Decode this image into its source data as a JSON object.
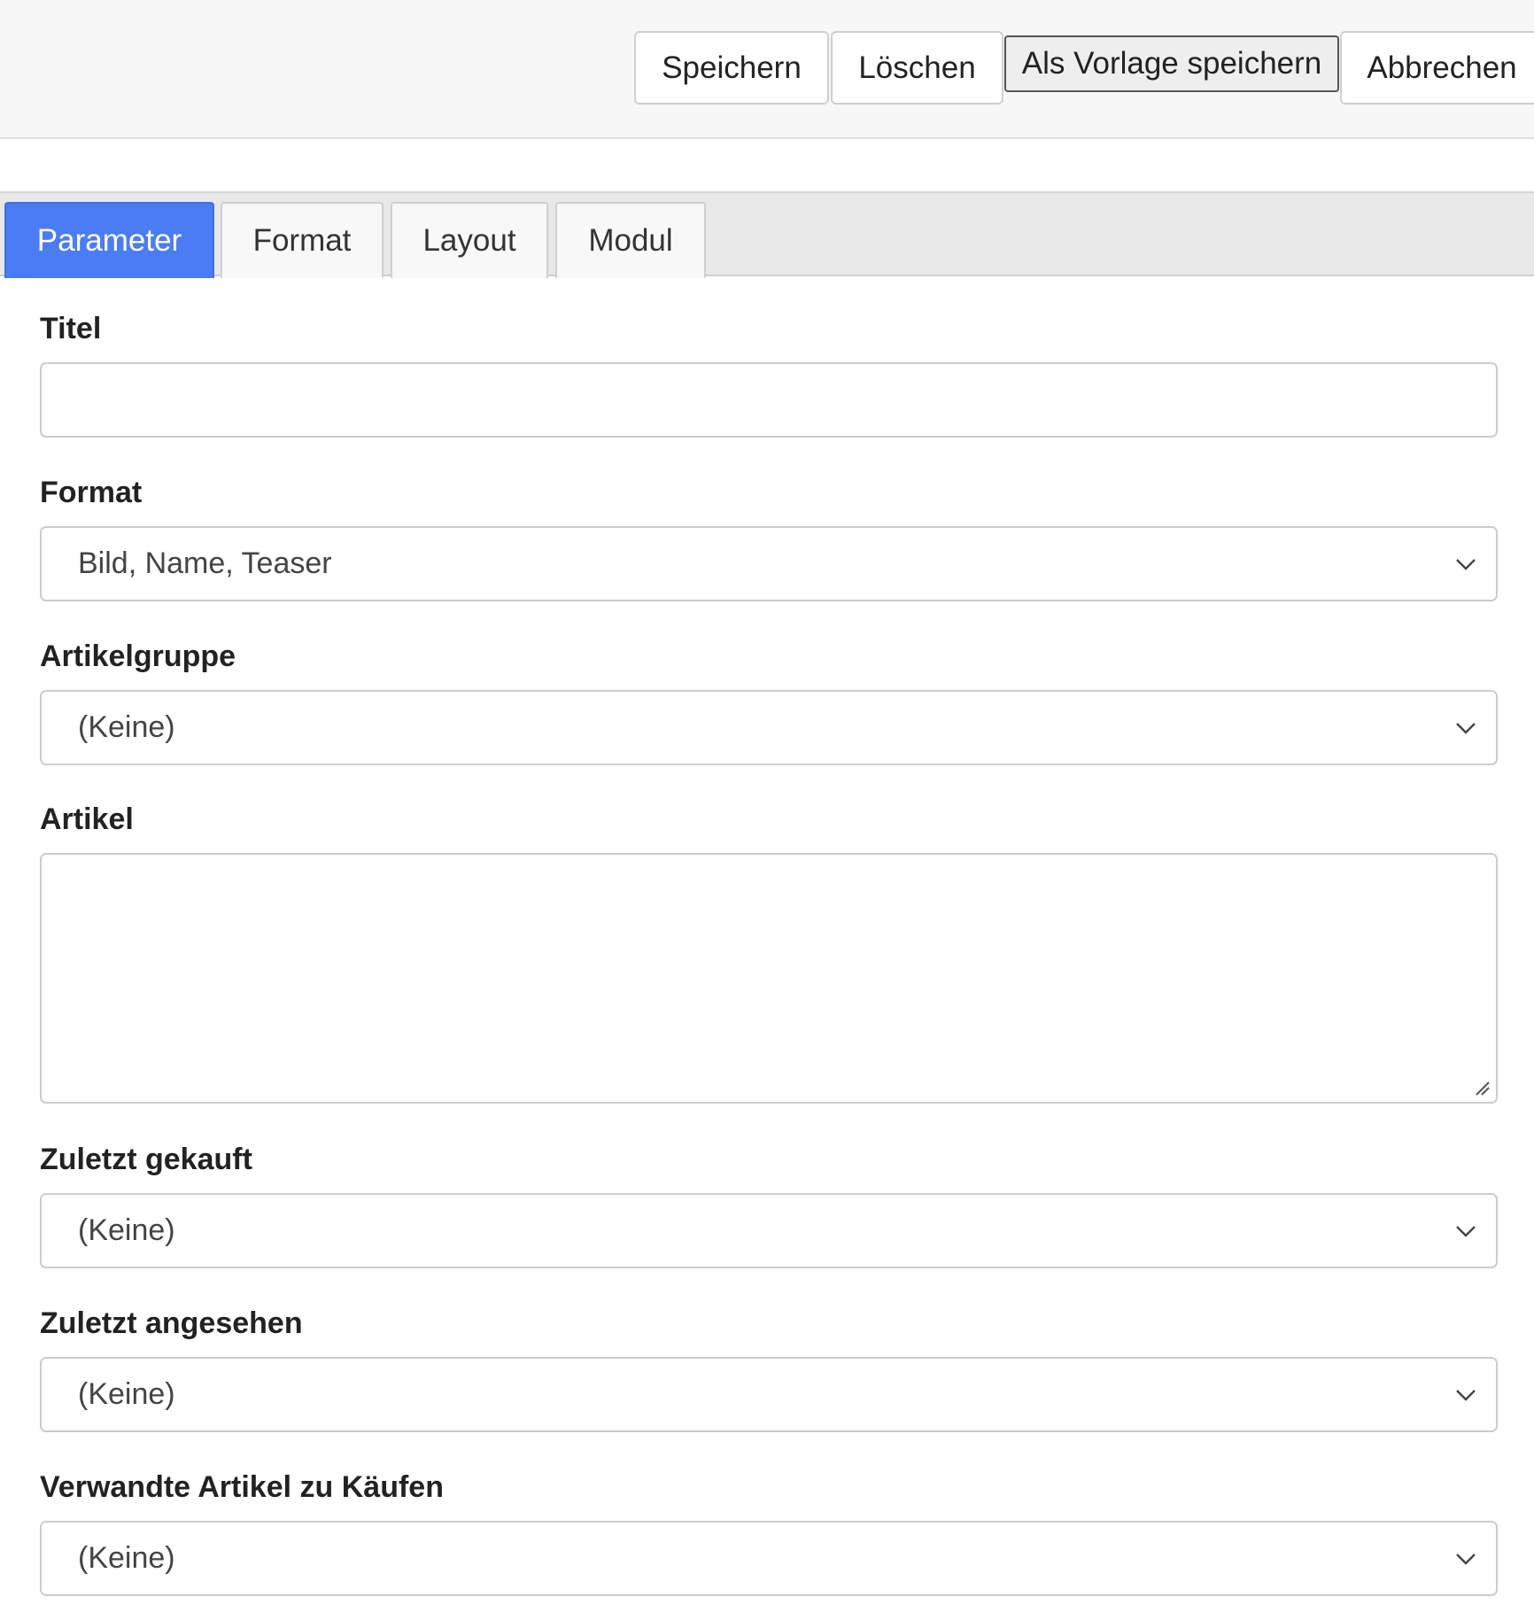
{
  "toolbar": {
    "save_label": "Speichern",
    "delete_label": "Löschen",
    "save_template_label": "Als Vorlage speichern",
    "cancel_label": "Abbrechen"
  },
  "tabs": [
    {
      "label": "Parameter",
      "active": true
    },
    {
      "label": "Format",
      "active": false
    },
    {
      "label": "Layout",
      "active": false
    },
    {
      "label": "Modul",
      "active": false
    }
  ],
  "form": {
    "title": {
      "label": "Titel",
      "value": ""
    },
    "format": {
      "label": "Format",
      "selected": "Bild, Name, Teaser"
    },
    "article_group": {
      "label": "Artikelgruppe",
      "selected": "(Keine)"
    },
    "article": {
      "label": "Artikel",
      "value": ""
    },
    "last_bought": {
      "label": "Zuletzt gekauft",
      "selected": "(Keine)"
    },
    "last_viewed": {
      "label": "Zuletzt angesehen",
      "selected": "(Keine)"
    },
    "related_to_buy": {
      "label": "Verwandte Artikel zu Käufen",
      "selected": "(Keine)"
    }
  },
  "icons": {
    "select_arrow": "chevron-down-icon",
    "textarea_resize": "resize-grip-icon"
  },
  "colors": {
    "active_tab": "#4a7cf6",
    "toolbar_bg": "#f7f7f7",
    "tabbar_bg": "#e8e8e8"
  }
}
